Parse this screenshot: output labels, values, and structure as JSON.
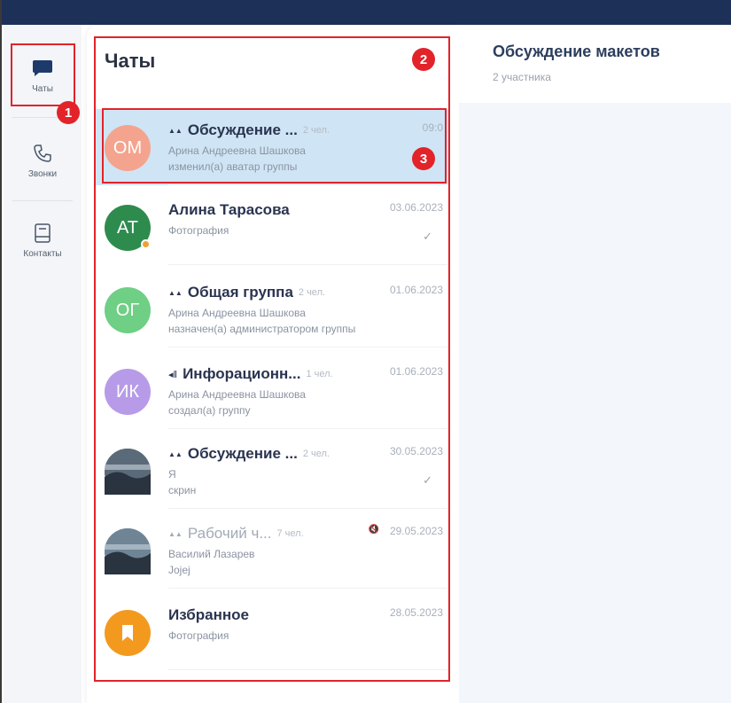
{
  "nav": {
    "items": [
      {
        "label": "Чаты",
        "icon": "chat-bubble-icon"
      },
      {
        "label": "Звонки",
        "icon": "phone-icon"
      },
      {
        "label": "Контакты",
        "icon": "contacts-book-icon"
      }
    ]
  },
  "chat_list": {
    "title": "Чаты",
    "chats": [
      {
        "initials": "ОМ",
        "avatar_color": "#f4a48e",
        "type": "group",
        "name": "Обсуждение ...",
        "members": "2 чел.",
        "date": "09:0",
        "line1": "Арина Андреевна Шашкова",
        "line2": "изменил(а) аватар группы",
        "active": true
      },
      {
        "initials": "АТ",
        "avatar_color": "#2e8b4e",
        "type": "person",
        "name": "Алина Тарасова",
        "members": "",
        "date": "03.06.2023",
        "line1": "Фотография",
        "line2": "",
        "read": "✓"
      },
      {
        "initials": "ОГ",
        "avatar_color": "#6fcf85",
        "type": "group",
        "name": "Общая группа",
        "members": "2 чел.",
        "date": "01.06.2023",
        "line1": "Арина Андреевна Шашкова",
        "line2": "назначен(а) администратором группы"
      },
      {
        "initials": "ИК",
        "avatar_color": "#b79be8",
        "type": "channel",
        "name": "Инфорационн...",
        "members": "1 чел.",
        "date": "01.06.2023",
        "line1": "Арина Андреевна Шашкова",
        "line2": "создал(а) группу"
      },
      {
        "initials": "",
        "avatar_color": "#5b6a78",
        "type": "group",
        "name": "Обсуждение ...",
        "members": "2 чел.",
        "date": "30.05.2023",
        "line1": "Я",
        "line2": "скрин",
        "read": "✓"
      },
      {
        "initials": "",
        "avatar_color": "#6f8596",
        "type": "group",
        "name": "Рабочий ч...",
        "members": "7 чел.",
        "date": "29.05.2023",
        "line1": "Василий Лазарев",
        "line2": "Jojej",
        "muted": true
      },
      {
        "initials": "",
        "avatar_color": "#f39a1e",
        "type": "saved",
        "name": "Избранное",
        "members": "",
        "date": "28.05.2023",
        "line1": "Фотография",
        "line2": ""
      }
    ]
  },
  "conversation": {
    "title": "Обсуждение макетов",
    "subtitle": "2 участника"
  },
  "annotations": {
    "markers": [
      "1",
      "2",
      "3"
    ],
    "color": "#e2232a"
  },
  "colors": {
    "topbar": "#1d3057",
    "active_chat": "#cfe5f5"
  }
}
